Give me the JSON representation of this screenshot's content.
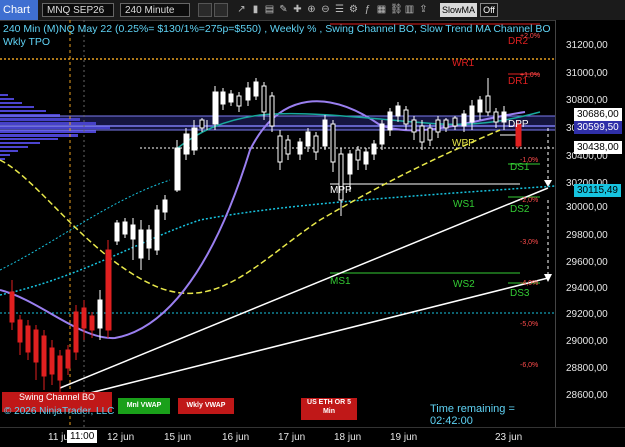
{
  "toolbar": {
    "chart_tab": "Chart",
    "instrument": "MNQ SEP26",
    "interval": "240 Minute",
    "slowma_label": "SlowMA",
    "off_label": "Off"
  },
  "header": {
    "line1": "240 Min (M)NQ May 22  (0.25%= $130/1%=275p=$550) , Weekly % , Swing Channel BO, Slow Trend MA Channel BO",
    "line2": "Wkly TPO"
  },
  "price_axis": {
    "ticks": [
      "31200,00",
      "31000,00",
      "30800,00",
      "30600,00",
      "30400,00",
      "30200,00",
      "30000,00",
      "29800,00",
      "29600,00",
      "29400,00",
      "29200,00",
      "29000,00",
      "28800,00",
      "28600,00"
    ],
    "labels": [
      {
        "text": "30686,00",
        "bg": "#ffffff",
        "fg": "#000000"
      },
      {
        "text": "30599,50",
        "bg": "#2f2fa8",
        "fg": "#ffffff"
      },
      {
        "text": "30438,00",
        "bg": "#ffffff",
        "fg": "#000000"
      },
      {
        "text": "30115,49",
        "bg": "#17c4e0",
        "fg": "#000000"
      }
    ]
  },
  "time_axis": {
    "labels": [
      "11 jun",
      "12 jun",
      "15 jun",
      "16 jun",
      "17 jun",
      "18 jun",
      "19 jun",
      "23 jun"
    ],
    "cursor_time": "11:00"
  },
  "levels": [
    {
      "text": "DR2",
      "color": "#e02020"
    },
    {
      "text": "WR1",
      "color": "#e02020"
    },
    {
      "text": "DR1",
      "color": "#e02020"
    },
    {
      "text": "DPP",
      "color": "#ffffff"
    },
    {
      "text": "WPP",
      "color": "#e8e84a"
    },
    {
      "text": "MPP",
      "color": "#ffffff"
    },
    {
      "text": "DS1",
      "color": "#33cc33"
    },
    {
      "text": "WS1",
      "color": "#33cc33"
    },
    {
      "text": "DS2",
      "color": "#33cc33"
    },
    {
      "text": "MS1",
      "color": "#33cc33"
    },
    {
      "text": "WS2",
      "color": "#33cc33"
    },
    {
      "text": "DS3",
      "color": "#33cc33"
    }
  ],
  "percent_labels": [
    "+2,0%",
    "+1,0%",
    "-1,0%",
    "-2,0%",
    "-3,0%",
    "-4,0%",
    "-5,0%",
    "-6,0%"
  ],
  "status_boxes": {
    "swing_channel": "Swing Channel BO",
    "mnl_vwap": "Mnl VWAP",
    "wkly_vwap": "Wkly VWAP",
    "us_eth": "US ETH OR 5 Min"
  },
  "copyright": "© 2026 NinjaTrader, LLC",
  "time_remaining": "Time remaining = 02:42:00",
  "colors": {
    "bull": "#ffffff",
    "bear": "#e02020",
    "accent": "#5fd3f5",
    "vwap_cyan": "#17c4e0",
    "ma_yellow": "#e8e84a",
    "purple": "#9a7ff0"
  }
}
